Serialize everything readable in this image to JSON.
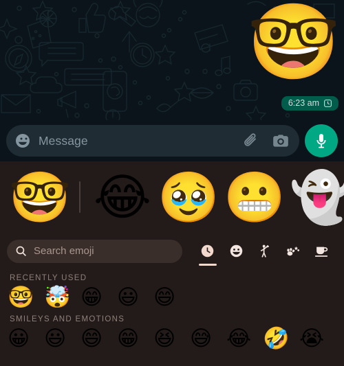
{
  "chat": {
    "sent_emoji": "🤓",
    "sent_emoji_name": "nerd-face",
    "timestamp": "6:23 am",
    "status_icon": "clock-icon",
    "bubble_color": "#005c4b",
    "background_color": "#0b141a"
  },
  "input_bar": {
    "emoji_button_icon": "smiley-icon",
    "placeholder": "Message",
    "attach_icon": "paperclip-icon",
    "camera_icon": "camera-icon",
    "mic_icon": "microphone-icon",
    "mic_button_color": "#00a884",
    "field_color": "#1f2c33"
  },
  "emoji_panel": {
    "background_color": "#231b19",
    "accent_color": "#f3d9cd",
    "suggestions": [
      {
        "char": "🤓",
        "name": "nerd-face"
      },
      {
        "char": "😂",
        "name": "face-with-tears-of-joy"
      },
      {
        "char": "🥹",
        "name": "face-holding-back-tears"
      },
      {
        "char": "😬",
        "name": "grimacing-face"
      },
      {
        "char": "👻",
        "name": "ghost"
      }
    ],
    "search": {
      "icon": "search-icon",
      "placeholder": "Search emoji",
      "value": ""
    },
    "categories": [
      {
        "name": "recent-tab",
        "icon": "clock-icon",
        "selected": true
      },
      {
        "name": "smileys-tab",
        "icon": "smiley-icon",
        "selected": false
      },
      {
        "name": "people-tab",
        "icon": "person-waving-icon",
        "selected": false
      },
      {
        "name": "animals-nature-tab",
        "icon": "paw-flower-icon",
        "selected": false
      },
      {
        "name": "food-drink-tab",
        "icon": "cup-saucer-icon",
        "selected": false
      }
    ],
    "sections": [
      {
        "title": "RECENTLY USED",
        "emojis": [
          {
            "char": "🤓",
            "name": "nerd-face"
          },
          {
            "char": "🤯",
            "name": "exploding-head"
          },
          {
            "char": "😁",
            "name": "beaming-face-with-smiling-eyes"
          },
          {
            "char": "😃",
            "name": "grinning-face-with-big-eyes"
          },
          {
            "char": "😄",
            "name": "grinning-face-with-smiling-eyes"
          }
        ]
      },
      {
        "title": "SMILEYS AND EMOTIONS",
        "emojis": [
          {
            "char": "😀",
            "name": "grinning-face"
          },
          {
            "char": "😃",
            "name": "grinning-face-with-big-eyes"
          },
          {
            "char": "😄",
            "name": "grinning-face-with-smiling-eyes"
          },
          {
            "char": "😁",
            "name": "beaming-face-with-smiling-eyes"
          },
          {
            "char": "😆",
            "name": "grinning-squinting-face"
          },
          {
            "char": "😅",
            "name": "grinning-face-with-sweat"
          },
          {
            "char": "😂",
            "name": "face-with-tears-of-joy"
          },
          {
            "char": "🤣",
            "name": "rolling-on-the-floor-laughing"
          },
          {
            "char": "😭",
            "name": "loudly-crying-face"
          }
        ]
      }
    ]
  }
}
